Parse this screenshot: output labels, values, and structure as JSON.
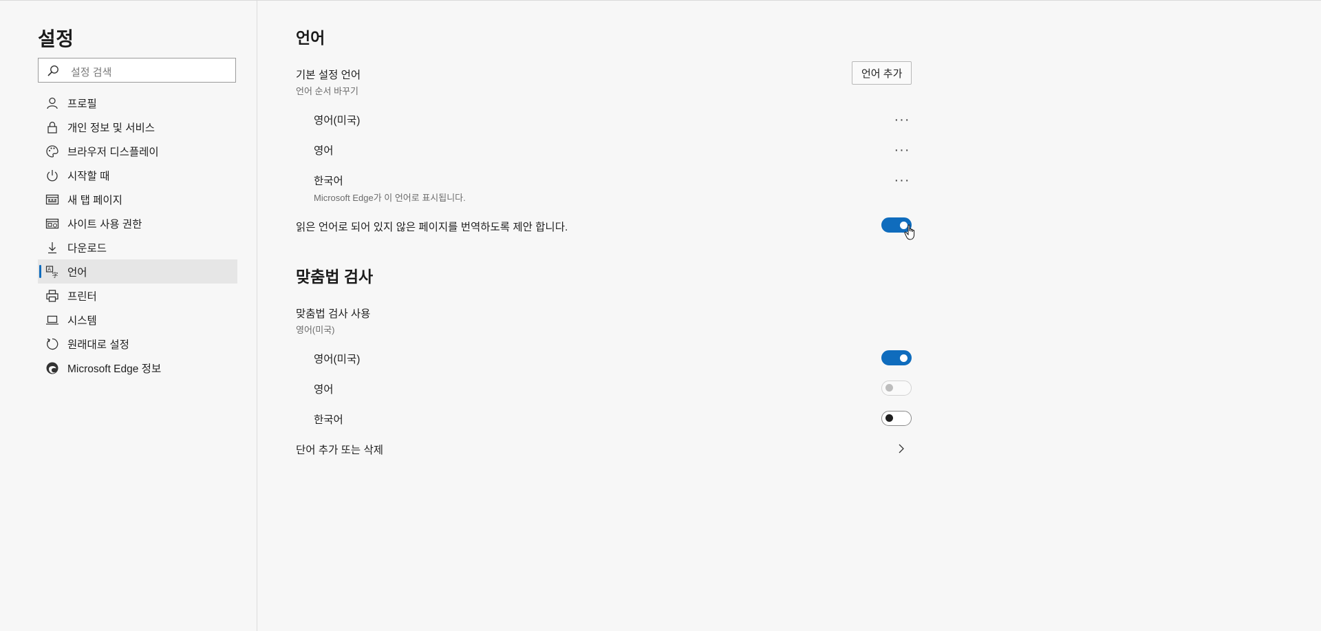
{
  "sidebar": {
    "title": "설정",
    "search_placeholder": "설정 검색",
    "items": [
      {
        "label": "프로필",
        "icon": "person-icon"
      },
      {
        "label": "개인 정보 및 서비스",
        "icon": "lock-icon"
      },
      {
        "label": "브라우저 디스플레이",
        "icon": "palette-icon"
      },
      {
        "label": "시작할 때",
        "icon": "power-icon"
      },
      {
        "label": "새 탭 페이지",
        "icon": "new-tab-icon"
      },
      {
        "label": "사이트 사용 권한",
        "icon": "site-permissions-icon"
      },
      {
        "label": "다운로드",
        "icon": "download-icon"
      },
      {
        "label": "언어",
        "icon": "language-icon",
        "active": true
      },
      {
        "label": "프린터",
        "icon": "printer-icon"
      },
      {
        "label": "시스템",
        "icon": "laptop-icon"
      },
      {
        "label": "원래대로 설정",
        "icon": "reset-icon"
      },
      {
        "label": "Microsoft Edge 정보",
        "icon": "edge-logo-icon"
      }
    ]
  },
  "language": {
    "heading": "언어",
    "preferred_title": "기본 설정 언어",
    "preferred_sub": "언어 순서 바꾸기",
    "add_button": "언어 추가",
    "languages": [
      {
        "name": "영어(미국)",
        "note": ""
      },
      {
        "name": "영어",
        "note": ""
      },
      {
        "name": "한국어",
        "note": "Microsoft Edge가 이 언어로 표시됩니다."
      }
    ],
    "more_glyph": "···",
    "offer_translate_label": "읽은 언어로 되어 있지 않은 페이지를 번역하도록 제안 합니다.",
    "offer_translate_on": true
  },
  "spellcheck": {
    "heading": "맞춤법 검사",
    "enable_title": "맞춤법 검사 사용",
    "enable_sub": "영어(미국)",
    "languages": [
      {
        "name": "영어(미국)",
        "state": "on"
      },
      {
        "name": "영어",
        "state": "disabled"
      },
      {
        "name": "한국어",
        "state": "off"
      }
    ],
    "words_label": "단어 추가 또는 삭제"
  },
  "colors": {
    "accent": "#0f6cbd",
    "background": "#f7f7f7",
    "active_nav": "#e6e6e6"
  }
}
